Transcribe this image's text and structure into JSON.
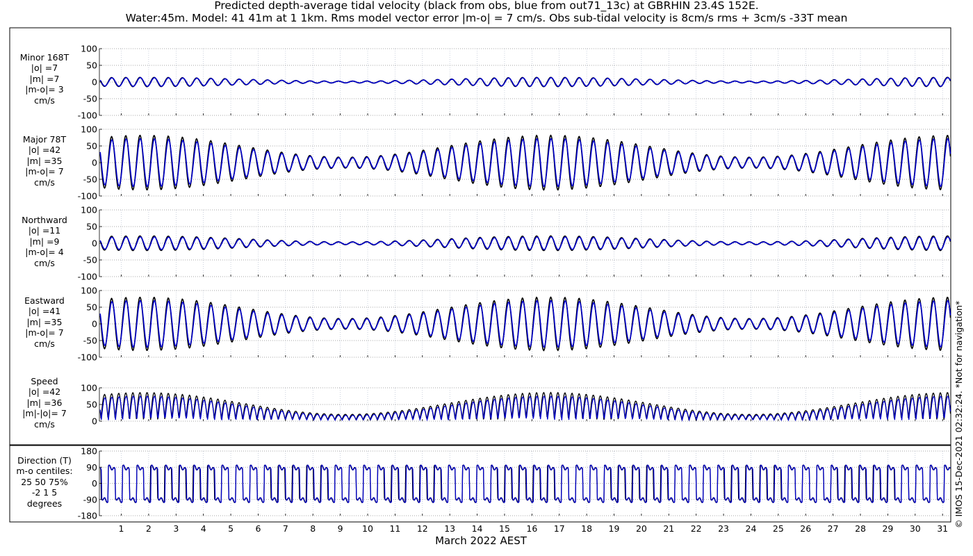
{
  "title": {
    "line1": "Predicted depth-average tidal velocity (black from obs, blue from out71_13c) at GBRHIN 23.4S 152E.",
    "line2": "Water:45m. Model: 41 41m at 1 1km. Rms model vector error |m-o| = 7 cm/s. Obs sub-tidal velocity is 8cm/s rms + 3cm/s -33T mean"
  },
  "footer_note": "© IMOS 15-Dec-2021 02:32:24. *Not for navigation*",
  "colors": {
    "obs": "#000000",
    "model": "#0000cc",
    "grid": "#888888"
  },
  "chart_data": {
    "type": "line",
    "xlabel": "March 2022 AEST",
    "xticks": [
      "1",
      "2",
      "3",
      "4",
      "5",
      "6",
      "7",
      "8",
      "9",
      "10",
      "11",
      "12",
      "13",
      "14",
      "15",
      "16",
      "17",
      "18",
      "19",
      "20",
      "21",
      "22",
      "23",
      "24",
      "25",
      "26",
      "27",
      "28",
      "29",
      "30",
      "31"
    ],
    "xlim": [
      0.2,
      31.3
    ],
    "legend": {
      "obs": "black from obs",
      "model": "blue from out71_13c"
    },
    "panels": [
      {
        "id": "minor",
        "kind": "velocity",
        "ylim": [
          -100,
          100
        ],
        "yticks": [
          "100",
          "50",
          "0",
          "-50",
          "-100"
        ],
        "labels": [
          "Minor 168T",
          "|o| =7",
          "|m| =7",
          "|m-o|= 3",
          "cm/s"
        ],
        "obs_amp": 14,
        "model_amp": 13
      },
      {
        "id": "major",
        "kind": "velocity",
        "ylim": [
          -100,
          100
        ],
        "yticks": [
          "100",
          "50",
          "0",
          "-50",
          "-100"
        ],
        "labels": [
          "Major 78T",
          "|o| =42",
          "|m| =35",
          "|m-o|= 7",
          "cm/s"
        ],
        "obs_amp": 82,
        "model_amp": 72
      },
      {
        "id": "northward",
        "kind": "velocity",
        "ylim": [
          -100,
          100
        ],
        "yticks": [
          "100",
          "50",
          "0",
          "-50",
          "-100"
        ],
        "labels": [
          "Northward",
          "|o| =11",
          "|m| =9",
          "|m-o|= 4",
          "cm/s"
        ],
        "obs_amp": 22,
        "model_amp": 19
      },
      {
        "id": "eastward",
        "kind": "velocity",
        "ylim": [
          -100,
          100
        ],
        "yticks": [
          "100",
          "50",
          "0",
          "-50",
          "-100"
        ],
        "labels": [
          "Eastward",
          "|o| =41",
          "|m| =35",
          "|m-o|= 7",
          "cm/s"
        ],
        "obs_amp": 80,
        "model_amp": 70
      },
      {
        "id": "speed",
        "kind": "speed",
        "ylim": [
          0,
          100
        ],
        "yticks": [
          "100",
          "50",
          "0"
        ],
        "labels": [
          "Speed",
          "|o| =42",
          "|m| =36",
          "|m|-|o|= 7",
          "cm/s"
        ],
        "obs_amp": 82,
        "model_amp": 72
      },
      {
        "id": "direction",
        "kind": "direction",
        "ylim": [
          -180,
          180
        ],
        "yticks": [
          "180",
          "90",
          "0",
          "-90",
          "-180"
        ],
        "labels": [
          "Direction (T)",
          "m-o centiles:",
          "25  50  75%",
          "-2  1  5",
          "degrees"
        ]
      }
    ]
  }
}
